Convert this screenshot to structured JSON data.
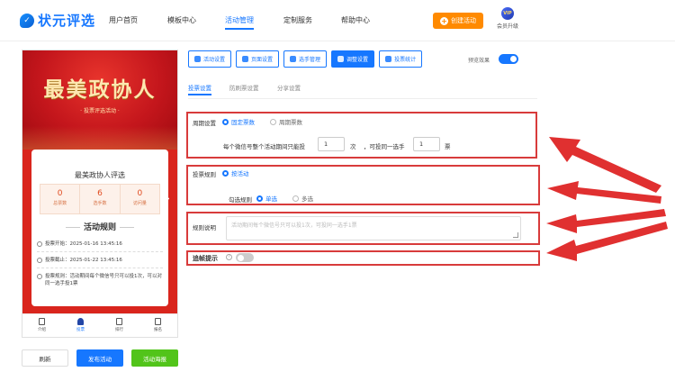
{
  "header": {
    "logo_text": "状元评选",
    "nav": [
      {
        "label": "用户首页",
        "active": false
      },
      {
        "label": "模板中心",
        "active": false
      },
      {
        "label": "活动管理",
        "active": true
      },
      {
        "label": "定制服务",
        "active": false
      },
      {
        "label": "帮助中心",
        "active": false
      }
    ],
    "create_label": "创建活动",
    "vip_badge": "VIP",
    "vip_label": "会员升级"
  },
  "preview": {
    "hero_title": "最美政协人",
    "hero_subtitle": "· 投票评选活动 ·",
    "card_title": "最美政协人评选",
    "stats": [
      {
        "value": "0",
        "label": "总票数"
      },
      {
        "value": "6",
        "label": "选手数"
      },
      {
        "value": "0",
        "label": "访问量"
      }
    ],
    "rules_heading": "活动规则",
    "rules": {
      "start": "投票开始：2025-01-16 13:45:16",
      "end": "投票截止：2025-01-22 13:45:16",
      "rule": "投票规则：活动期间每个微信号只可以投1次，可以对同一选手投1票"
    },
    "tabbar": [
      {
        "label": "介绍",
        "active": false
      },
      {
        "label": "投票",
        "active": true
      },
      {
        "label": "排行",
        "active": false
      },
      {
        "label": "报名",
        "active": false
      }
    ]
  },
  "footer": {
    "refresh": "刷新",
    "publish": "发布活动",
    "poster": "活动海报"
  },
  "toolbar": {
    "buttons": [
      {
        "label": "活动设置",
        "icon": "gear-icon",
        "active": false
      },
      {
        "label": "页面设置",
        "icon": "page-icon",
        "active": false
      },
      {
        "label": "选手管理",
        "icon": "users-icon",
        "active": false
      },
      {
        "label": "调整设置",
        "icon": "sliders-icon",
        "active": true
      },
      {
        "label": "投票统计",
        "icon": "chart-icon",
        "active": false
      }
    ],
    "preview_label": "预览效果",
    "preview_on": true
  },
  "subtabs": [
    {
      "label": "投票设置",
      "active": true
    },
    {
      "label": "防刷票设置",
      "active": false
    },
    {
      "label": "分享设置",
      "active": false
    }
  ],
  "form": {
    "period_label": "周期设置",
    "period_fixed": "固定票数",
    "period_cycle": "周期票数",
    "per_wechat_text": "每个微信号整个活动期间只能投",
    "per_wechat_value": "1",
    "unit_times": "次",
    "same_player_text": "，可投同一选手",
    "same_player_value": "1",
    "unit_votes": "票",
    "rule_label": "投票规则",
    "rule_activity": "按活动",
    "check_label": "勾选规则",
    "check_single": "单选",
    "check_multi": "多选",
    "desc_label": "规则说明",
    "desc_placeholder": "活动期间每个微信号只可以投1次，可投同一选手1票",
    "block_label": "追帧提示",
    "help_glyph": "?"
  },
  "colors": {
    "accent": "#1677ff",
    "orange": "#ff8a00",
    "green": "#52c41a",
    "highlight": "#d83b3b",
    "poster_red": "#d9251d"
  }
}
